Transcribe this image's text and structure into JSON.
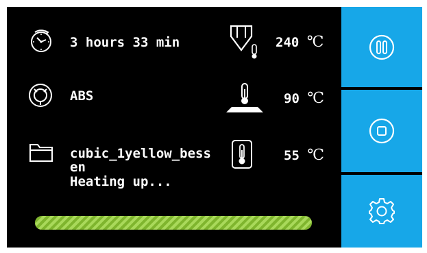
{
  "status": {
    "time_remaining": "3 hours 33 min",
    "filament": "ABS",
    "file_line1": "cubic_1yellow_bess",
    "file_line2": "en",
    "state_text": "Heating up..."
  },
  "temps": {
    "nozzle": "240",
    "bed": "90",
    "chamber": "55",
    "unit": "℃"
  },
  "progress": {
    "fraction": 1.0
  },
  "sidebar": {
    "buttons": [
      "pause",
      "stop",
      "settings"
    ]
  },
  "icons": {
    "timer": "timer-icon",
    "filament": "filament-spool-icon",
    "folder": "folder-icon",
    "nozzle": "nozzle-temp-icon",
    "bed": "bed-temp-icon",
    "chamber": "chamber-thermometer-icon",
    "pause": "pause-icon",
    "stop": "stop-icon",
    "settings": "gear-icon"
  },
  "colors": {
    "background": "#000000",
    "sidebar": "#17a7e8",
    "progress": "#9ccf4a",
    "text": "#ffffff"
  }
}
